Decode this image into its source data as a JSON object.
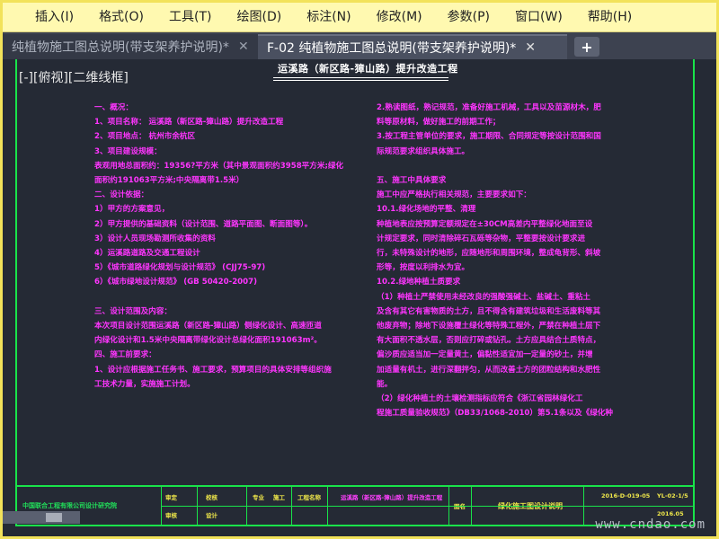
{
  "menubar": {
    "items": [
      "插入(I)",
      "格式(O)",
      "工具(T)",
      "绘图(D)",
      "标注(N)",
      "修改(M)",
      "参数(P)",
      "窗口(W)",
      "帮助(H)"
    ]
  },
  "tabs": [
    {
      "label": "纯植物施工图总说明(带支架养护说明)*",
      "active": false
    },
    {
      "label": "F-02 纯植物施工图总说明(带支架养护说明)*",
      "active": true
    }
  ],
  "viewport": {
    "view_label": "[-][俯视][二维线框]"
  },
  "drawing": {
    "title": "运溪路（新区路-獐山路）提升改造工程",
    "left_column": [
      {
        "text": "一、概况：",
        "yellow": false
      },
      {
        "text": "    1、项目名称：  运溪路（新区路-獐山路）提升改造工程",
        "yellow": false
      },
      {
        "text": "    2、项目地点：  杭州市余杭区",
        "yellow": false
      },
      {
        "text": "    3、项目建设规模：",
        "yellow": false
      },
      {
        "text": "    表观用地总面积约：19356?平方米（其中景观面积约3958平方米;绿化",
        "yellow": false
      },
      {
        "text": "面积约191063平方米;中央隔离带1.5米）",
        "yellow": false
      },
      {
        "text": "二、设计依据：",
        "yellow": false
      },
      {
        "text": "    1）甲方的方案意见，",
        "yellow": false
      },
      {
        "text": "    2）甲方提供的基础资料（设计范围、道路平面图、断面图等）。",
        "yellow": false
      },
      {
        "text": "    3）设计人员现场勘测所收集的资料",
        "yellow": false
      },
      {
        "text": "    4）运溪路道路及交通工程设计",
        "yellow": false
      },
      {
        "text": "    5）《城市道路绿化规划与设计规范》  (CJJ75-97)",
        "yellow": false
      },
      {
        "text": "    6）《城市绿地设计规范》  (GB 50420-2007)",
        "yellow": false
      },
      {
        "text": "",
        "yellow": false
      },
      {
        "text": "三、设计范围及内容：",
        "yellow": false
      },
      {
        "text": "    本次项目设计范围运溪路（新区路-獐山路）侧绿化设计、高速匝道",
        "yellow": false
      },
      {
        "text": "内绿化设计和1.5米中央隔离带绿化设计总绿化面积191063m²。",
        "yellow": false
      },
      {
        "text": "四、施工前要求：",
        "yellow": false
      },
      {
        "text": "    1、设计应根据施工任务书、施工要求，预算项目的具体安排等组织施",
        "yellow": false
      },
      {
        "text": "工技术力量，实施施工计划。",
        "yellow": false
      }
    ],
    "right_column": [
      {
        "text": "          2.熟读图纸，熟记规范，准备好施工机械，工具以及苗源材木，肥",
        "yellow": false
      },
      {
        "text": "料等原材料，做好施工的前期工作；",
        "yellow": false
      },
      {
        "text": "          3.按工程主管单位的要求，施工期限、合同规定等按设计范围和国",
        "yellow": false
      },
      {
        "text": "际规范要求组织具体施工。",
        "yellow": false
      },
      {
        "text": "",
        "yellow": false
      },
      {
        "text": "五、施工中具体要求",
        "yellow": false
      },
      {
        "text": "    施工中应严格执行相关规范，主要要求如下：",
        "yellow": false
      },
      {
        "text": "    10.1.绿化场地的平整、清理",
        "yellow": false
      },
      {
        "text": "    种植地表应按预算定额规定在±30CM高差内平整绿化地面至设",
        "yellow": false
      },
      {
        "text": "计规定要求，同时清除碎石瓦砾等杂物，平整要按设计要求进",
        "yellow": false
      },
      {
        "text": "行，未特殊设计的地形，应随地形和周围环境，整成龟背形、斜坡",
        "yellow": false
      },
      {
        "text": "形等，按度以利排水为宜。",
        "yellow": false
      },
      {
        "text": "          10.2.绿地种植土质要求",
        "yellow": false
      },
      {
        "text": "    （1）种植土严禁使用未经改良的强酸强碱土、盐碱土、重粘土",
        "yellow": false
      },
      {
        "text": "及含有其它有害物质的土方，且不得含有建筑垃圾和生活废料等其",
        "yellow": false
      },
      {
        "text": "他废弃物；除地下设施覆土绿化等特殊工程外，严禁在种植土层下",
        "yellow": false
      },
      {
        "text": "有大面积不透水层，否则应打碎或钻孔。土方应具结合土质特点，",
        "yellow": false
      },
      {
        "text": "偏沙质应适当加一定量黄土，偏黏性适宜加一定量的砂土，并增",
        "yellow": false
      },
      {
        "text": "加适量有机土，进行深翻拌匀，从而改善土方的团粒结构和水肥性",
        "yellow": false
      },
      {
        "text": "能。",
        "yellow": false
      },
      {
        "text": "    （2）绿化种植土的土壤检测指标应符合《浙江省园林绿化工",
        "yellow": false
      },
      {
        "text": "程施工质量验收规范》（DB33/1068-2010）第5.1条以及《绿化种",
        "yellow": false
      }
    ],
    "title_block": {
      "company": "中国联合工程有限公司设计研究院",
      "labels": [
        "审定",
        "校核",
        "专业",
        "施工",
        "工程名称",
        "审核",
        "设计",
        "图名"
      ],
      "project": "运溪路（新区路-獐山路）提升改造工程",
      "drawing_name": "绿化施工图设计说明",
      "sheet_no": "YL-02-1/5",
      "date": "2016.05",
      "job_no": "2016-D-019-05"
    }
  },
  "statusbar": {
    "watermark": "www.cndao.com"
  },
  "colors": {
    "drawing_bg": "#252a35",
    "frame_green": "#19e34a",
    "text_magenta": "#ff35ff",
    "text_yellow": "#f0e84a",
    "menubar_bg": "#fff9b0"
  }
}
